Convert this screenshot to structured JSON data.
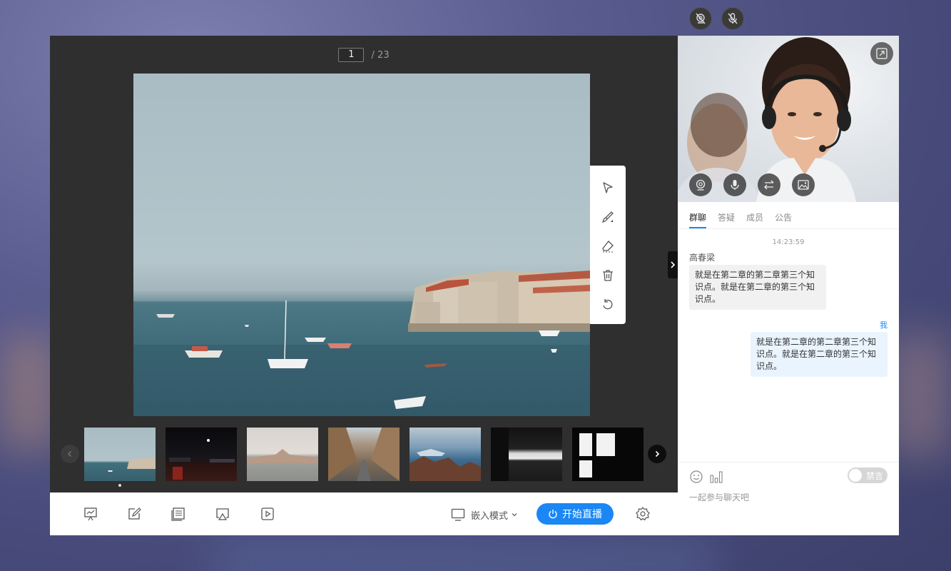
{
  "top_controls": {
    "camera_off_icon": "camera-off-icon",
    "mic_off_icon": "mic-off-icon"
  },
  "pager": {
    "current": "1",
    "total_text": "/ 23"
  },
  "slide": {
    "subject": "harbor-with-boats-and-old-town"
  },
  "whiteboard_tools": [
    "select-pointer",
    "pen",
    "eraser",
    "delete",
    "undo"
  ],
  "thumbnails": [
    {
      "theme": "harbor"
    },
    {
      "theme": "night-street"
    },
    {
      "theme": "city-across-water"
    },
    {
      "theme": "village-street"
    },
    {
      "theme": "rocky-coast"
    },
    {
      "theme": "dark-room-window"
    },
    {
      "theme": "silhouette-window"
    }
  ],
  "bottom_toolbar": {
    "icons": [
      "presentation-icon",
      "whiteboard-icon",
      "document-icon",
      "screen-share-icon",
      "video-play-icon"
    ],
    "mode_label": "嵌入模式",
    "start_live_label": "开始直播"
  },
  "video_panel": {
    "controls": [
      "camera-icon",
      "microphone-icon",
      "switch-icon",
      "image-icon"
    ]
  },
  "chat": {
    "tabs": [
      {
        "label": "群聊",
        "active": true
      },
      {
        "label": "答疑",
        "active": false
      },
      {
        "label": "成员",
        "active": false
      },
      {
        "label": "公告",
        "active": false
      }
    ],
    "time": "14:23:59",
    "messages": [
      {
        "sender": "高春梁",
        "text": "就是在第二章的第二章第三个知识点。就是在第二章的第三个知识点。",
        "mine": false
      },
      {
        "sender": "我",
        "text": "就是在第二章的第二章第三个知识点。就是在第二章的第三个知识点。",
        "mine": true
      }
    ],
    "mute_label": "禁言",
    "input_placeholder": "一起参与聊天吧"
  },
  "colors": {
    "accent": "#1a87f5",
    "stage_bg": "#2f2f2f",
    "panel_bg": "#ffffff"
  }
}
